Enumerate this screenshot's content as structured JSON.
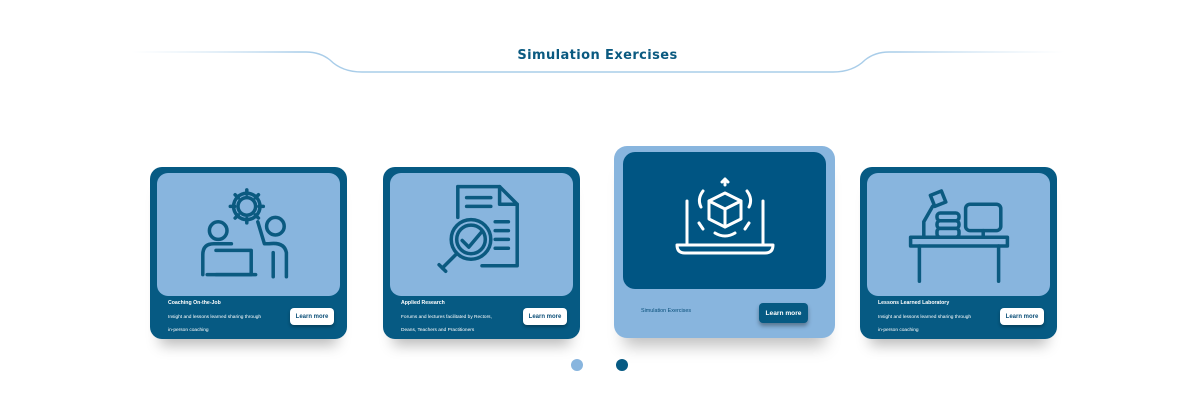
{
  "page": {
    "title": "Simulation Exercises"
  },
  "colors": {
    "primary": "#065a83",
    "light": "#88b5de",
    "text": "#0b5a80"
  },
  "cards": [
    {
      "icon": "team-gear-icon",
      "title": "Coaching On-the-Job",
      "description": "Insight and lessons learned sharing through in-person coaching",
      "button": "Learn more",
      "active": false
    },
    {
      "icon": "document-magnifier-check-icon",
      "title": "Applied Research",
      "description": "Forums and lectures facilitated by Rectors, Deans, Teachers and Practitioners",
      "button": "Learn more",
      "active": false
    },
    {
      "icon": "laptop-cube-icon",
      "title": "Simulation Exercises",
      "description": "",
      "button": "Learn more",
      "active": true
    },
    {
      "icon": "desk-lamp-computer-icon",
      "title": "Lessons Learned Laboratory",
      "description": "Insight and lessons learned sharing through in-person coaching",
      "button": "Learn more",
      "active": false
    }
  ],
  "carousel": {
    "pages": 2,
    "current_page": 2
  }
}
